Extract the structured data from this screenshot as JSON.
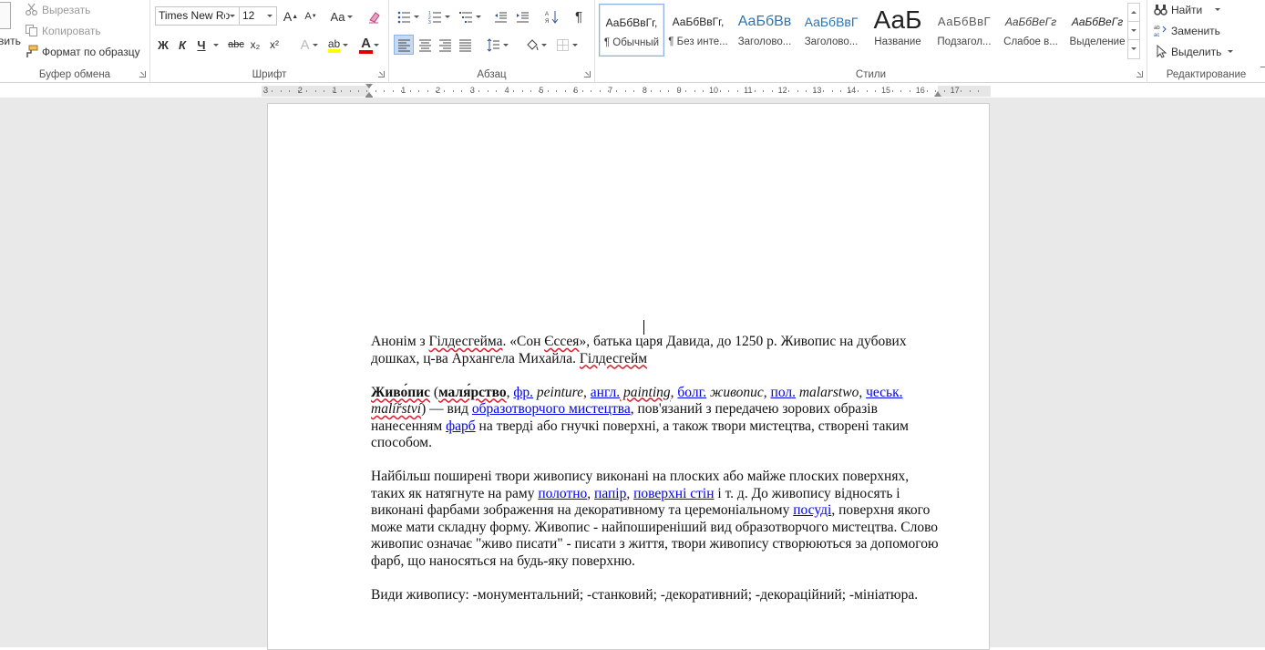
{
  "ribbon": {
    "clipboard": {
      "label": "Буфер обмена",
      "paste_label": "вить",
      "cut": "Вырезать",
      "copy": "Копировать",
      "format_painter": "Формат по образцу"
    },
    "font": {
      "label": "Шрифт",
      "font_name": "Times New Ro",
      "font_size": "12",
      "bold": "Ж",
      "italic": "К",
      "underline": "Ч",
      "strike": "abc",
      "subscript": "x₂",
      "superscript": "x²",
      "grow": "A",
      "shrink": "A",
      "case": "Aa",
      "effects": "A",
      "highlight": "ab",
      "font_color": "A",
      "highlight_color": "#ffff00",
      "font_color_value": "#e00000"
    },
    "paragraph": {
      "label": "Абзац",
      "pilcrow": "¶"
    },
    "styles": {
      "label": "Стили",
      "items": [
        {
          "preview": "АаБбВвГг,",
          "name": "¶ Обычный"
        },
        {
          "preview": "АаБбВвГг,",
          "name": "¶ Без инте..."
        },
        {
          "preview": "АаБбВв",
          "name": "Заголово..."
        },
        {
          "preview": "АаБбВвГ",
          "name": "Заголово..."
        },
        {
          "preview": "АаБ",
          "name": "Название"
        },
        {
          "preview": "АаБбВвГ",
          "name": "Подзагол..."
        },
        {
          "preview": "АаБбВеГг",
          "name": "Слабое в..."
        },
        {
          "preview": "АаБбВеГг",
          "name": "Выделение"
        }
      ]
    },
    "editing": {
      "label": "Редактирование",
      "find": "Найти",
      "replace": "Заменить",
      "select": "Выделить"
    }
  },
  "ruler": {
    "labels": [
      "3",
      "2",
      "1",
      "1",
      "2",
      "3",
      "4",
      "5",
      "6",
      "7",
      "8",
      "9",
      "10",
      "11",
      "12",
      "13",
      "14",
      "15",
      "16",
      "17"
    ]
  },
  "document": {
    "p1": {
      "a": "Анонім з ",
      "b": "Гілдесгейма",
      "c": ". «Сон ",
      "d": "Єссея",
      "e": "», батька царя Давида, до 1250 р. Живопис на дубових дошках, ц-ва Архангела Михайла. ",
      "f": "Гілдесгейм"
    },
    "p2": {
      "term": "Живо́пис",
      "open": " (",
      "syn": "маля́рство",
      "c1": ", ",
      "fr": "фр.",
      "fr_w": " peinture",
      "c2": ", ",
      "en": "англ.",
      "en_w": " painting",
      "c3": ", ",
      "bg": "болг.",
      "bg_w": " живопис",
      "c4": ", ",
      "pl": "пол.",
      "pl_w": " malarstwo",
      "c5": ", ",
      "cz": "чеськ.",
      "cz_w": " malířství",
      "close": ") — вид ",
      "link1": "образотворчого мистецтва",
      "rest1": ", пов'язаний з передачею зорових образів нанесенням ",
      "link2": "фарб",
      "rest2": " на тверді або гнучкі поверхні, а також твори мистецтва, створені таким способом."
    },
    "p3": {
      "a": "Найбільш поширені твори живопису виконані на плоских або майже плоских поверхнях, таких як натягнуте на раму ",
      "l1": "полотно",
      "s1": ", ",
      "l2": "папір",
      "s2": ", ",
      "l3": "поверхні стін",
      "b": " і т. д. До живопису відносять і виконані фарбами зображення на декоративному та церемоніальному ",
      "l4": "посуді",
      "c": ", поверхня якого може мати складну форму. Живопис - найпоширеніший вид образотворчого мистецтва. Слово живопис означає \"живо писати\" - писати з життя, твори живопису створюються за допомогою фарб, що наносяться на будь-яку поверхню."
    },
    "p4": "Види живопису: -монументальний; -станковий; -декоративний; -декораційний; -мініатюра."
  }
}
